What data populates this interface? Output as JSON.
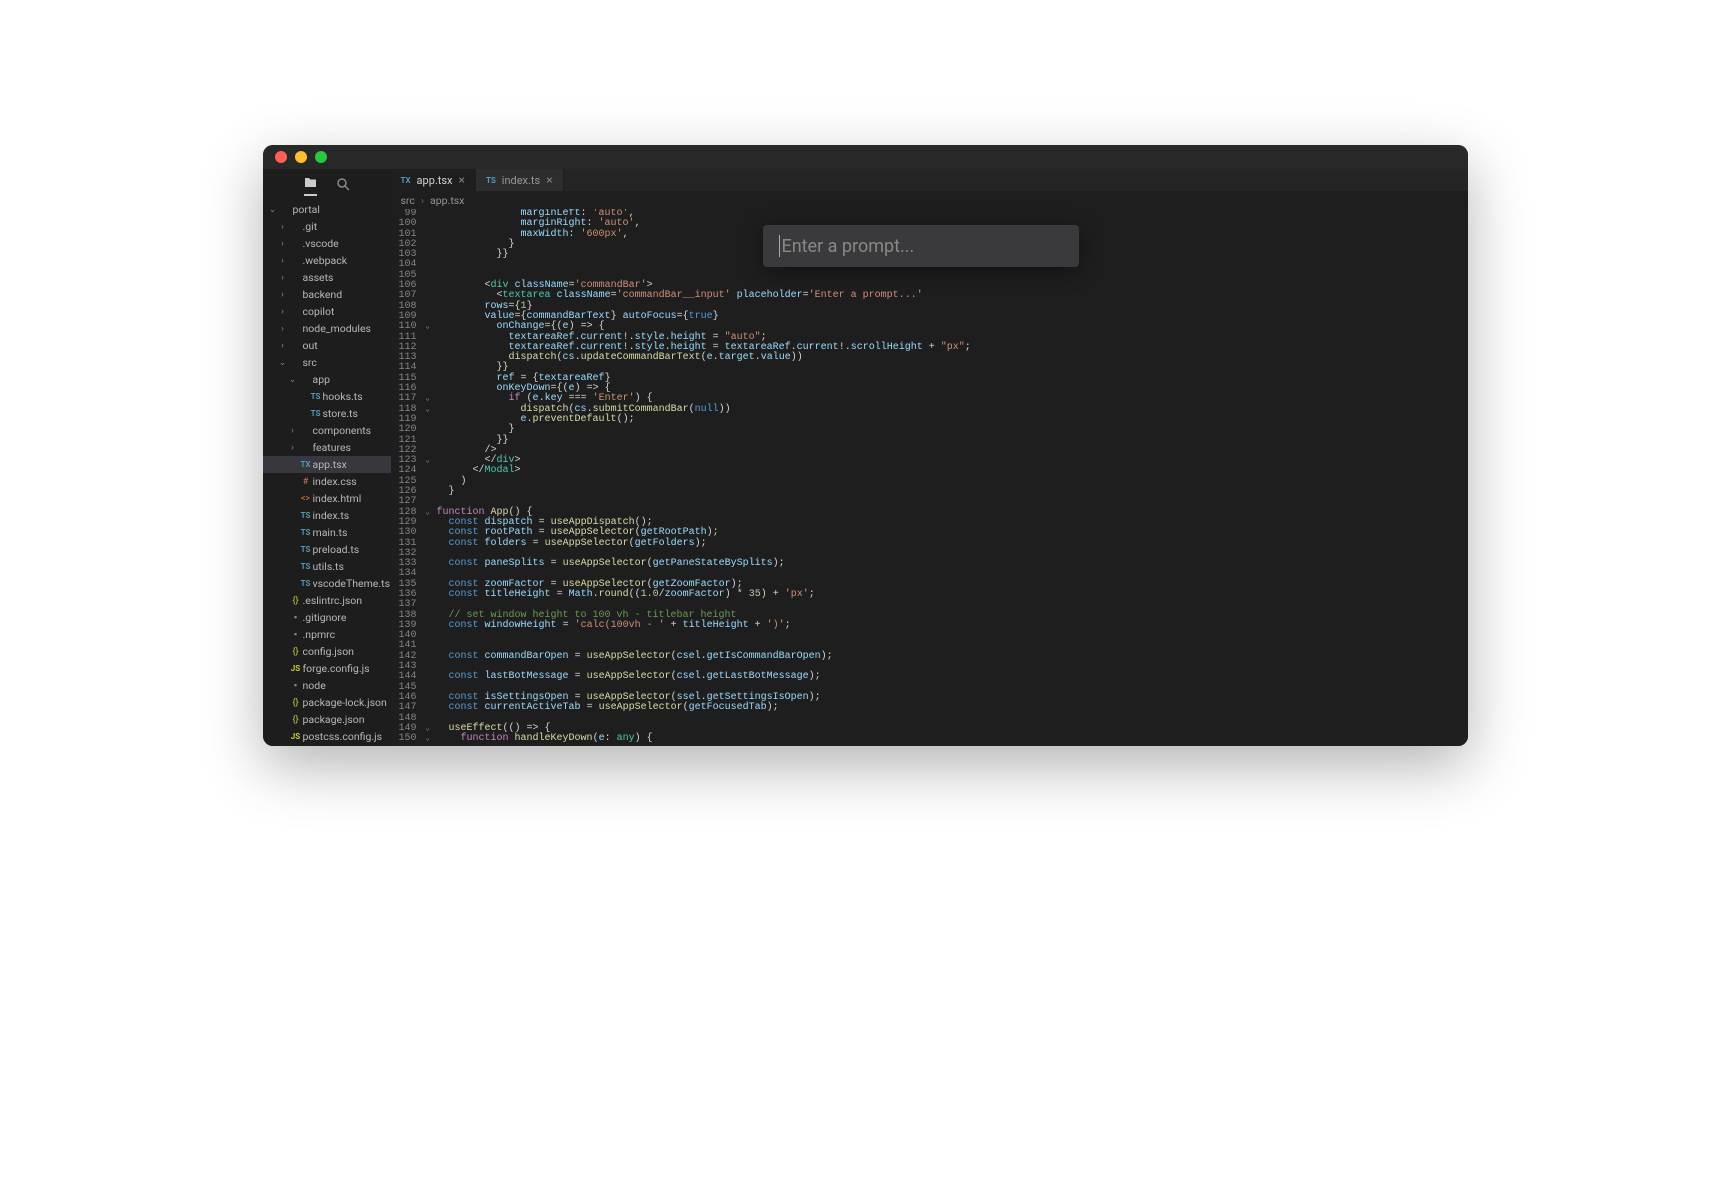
{
  "tabs": [
    {
      "icon": "TX",
      "label": "app.tsx",
      "active": true
    },
    {
      "icon": "TS",
      "label": "index.ts",
      "active": false
    }
  ],
  "breadcrumbs": [
    "src",
    "app.tsx"
  ],
  "prompt_placeholder": "Enter a prompt...",
  "sidebar_icons": {
    "folder": "folder-icon",
    "search": "search-icon"
  },
  "file_tree": [
    {
      "depth": 0,
      "chev": "v",
      "icon": "",
      "label": "portal",
      "type": "folder-open"
    },
    {
      "depth": 1,
      "chev": ">",
      "icon": "",
      "label": ".git",
      "type": "folder"
    },
    {
      "depth": 1,
      "chev": ">",
      "icon": "",
      "label": ".vscode",
      "type": "folder"
    },
    {
      "depth": 1,
      "chev": ">",
      "icon": "",
      "label": ".webpack",
      "type": "folder"
    },
    {
      "depth": 1,
      "chev": ">",
      "icon": "",
      "label": "assets",
      "type": "folder"
    },
    {
      "depth": 1,
      "chev": ">",
      "icon": "",
      "label": "backend",
      "type": "folder"
    },
    {
      "depth": 1,
      "chev": ">",
      "icon": "",
      "label": "copilot",
      "type": "folder"
    },
    {
      "depth": 1,
      "chev": ">",
      "icon": "",
      "label": "node_modules",
      "type": "folder"
    },
    {
      "depth": 1,
      "chev": ">",
      "icon": "",
      "label": "out",
      "type": "folder"
    },
    {
      "depth": 1,
      "chev": "v",
      "icon": "",
      "label": "src",
      "type": "folder-open"
    },
    {
      "depth": 2,
      "chev": "v",
      "icon": "",
      "label": "app",
      "type": "folder-open"
    },
    {
      "depth": 3,
      "chev": "",
      "icon": "TS",
      "label": "hooks.ts",
      "type": "ts"
    },
    {
      "depth": 3,
      "chev": "",
      "icon": "TS",
      "label": "store.ts",
      "type": "ts"
    },
    {
      "depth": 2,
      "chev": ">",
      "icon": "",
      "label": "components",
      "type": "folder"
    },
    {
      "depth": 2,
      "chev": ">",
      "icon": "",
      "label": "features",
      "type": "folder"
    },
    {
      "depth": 2,
      "chev": "",
      "icon": "TX",
      "label": "app.tsx",
      "type": "tx",
      "selected": true
    },
    {
      "depth": 2,
      "chev": "",
      "icon": "#",
      "label": "index.css",
      "type": "css"
    },
    {
      "depth": 2,
      "chev": "",
      "icon": "<>",
      "label": "index.html",
      "type": "html"
    },
    {
      "depth": 2,
      "chev": "",
      "icon": "TS",
      "label": "index.ts",
      "type": "ts"
    },
    {
      "depth": 2,
      "chev": "",
      "icon": "TS",
      "label": "main.ts",
      "type": "ts"
    },
    {
      "depth": 2,
      "chev": "",
      "icon": "TS",
      "label": "preload.ts",
      "type": "ts"
    },
    {
      "depth": 2,
      "chev": "",
      "icon": "TS",
      "label": "utils.ts",
      "type": "ts"
    },
    {
      "depth": 2,
      "chev": "",
      "icon": "TS",
      "label": "vscodeTheme.ts",
      "type": "ts"
    },
    {
      "depth": 1,
      "chev": "",
      "icon": "{}",
      "label": ".eslintrc.json",
      "type": "json"
    },
    {
      "depth": 1,
      "chev": "",
      "icon": "▪",
      "label": ".gitignore",
      "type": "file"
    },
    {
      "depth": 1,
      "chev": "",
      "icon": "▪",
      "label": ".npmrc",
      "type": "file"
    },
    {
      "depth": 1,
      "chev": "",
      "icon": "{}",
      "label": "config.json",
      "type": "json"
    },
    {
      "depth": 1,
      "chev": "",
      "icon": "JS",
      "label": "forge.config.js",
      "type": "js"
    },
    {
      "depth": 1,
      "chev": "",
      "icon": "▪",
      "label": "node",
      "type": "file"
    },
    {
      "depth": 1,
      "chev": "",
      "icon": "{}",
      "label": "package-lock.json",
      "type": "json"
    },
    {
      "depth": 1,
      "chev": "",
      "icon": "{}",
      "label": "package.json",
      "type": "json"
    },
    {
      "depth": 1,
      "chev": "",
      "icon": "JS",
      "label": "postcss.config.js",
      "type": "js"
    }
  ],
  "line_start": 99,
  "line_end": 150,
  "fold_marks": {
    "110": "v",
    "117": "v",
    "118": "v",
    "123": "v",
    "128": "v",
    "149": "v",
    "150": "v"
  },
  "code_lines": [
    [
      [
        "",
        "              "
      ],
      [
        "c-id",
        "marginLeft"
      ],
      [
        "c-pun",
        ": "
      ],
      [
        "c-str",
        "'auto'"
      ],
      [
        "c-pun",
        ","
      ]
    ],
    [
      [
        "",
        "              "
      ],
      [
        "c-id",
        "marginRight"
      ],
      [
        "c-pun",
        ": "
      ],
      [
        "c-str",
        "'auto'"
      ],
      [
        "c-pun",
        ","
      ]
    ],
    [
      [
        "",
        "              "
      ],
      [
        "c-id",
        "maxWidth"
      ],
      [
        "c-pun",
        ": "
      ],
      [
        "c-str",
        "'600px'"
      ],
      [
        "c-pun",
        ","
      ]
    ],
    [
      [
        "",
        "            }"
      ]
    ],
    [
      [
        "",
        "          }}"
      ]
    ],
    [
      [
        "",
        "        "
      ]
    ],
    [
      [
        "",
        " "
      ]
    ],
    [
      [
        "",
        "        "
      ],
      [
        "c-pun",
        "<"
      ],
      [
        "c-tag",
        "div"
      ],
      [
        "c-pun",
        " "
      ],
      [
        "c-attr",
        "className"
      ],
      [
        "c-pun",
        "="
      ],
      [
        "c-str",
        "'commandBar'"
      ],
      [
        "c-pun",
        ">"
      ]
    ],
    [
      [
        "",
        "          "
      ],
      [
        "c-pun",
        "<"
      ],
      [
        "c-tag",
        "textarea"
      ],
      [
        "c-pun",
        " "
      ],
      [
        "c-attr",
        "className"
      ],
      [
        "c-pun",
        "="
      ],
      [
        "c-str",
        "'commandBar__input'"
      ],
      [
        "c-pun",
        " "
      ],
      [
        "c-attr",
        "placeholder"
      ],
      [
        "c-pun",
        "="
      ],
      [
        "c-str",
        "'Enter a prompt...'"
      ]
    ],
    [
      [
        "",
        "        "
      ],
      [
        "c-attr",
        "rows"
      ],
      [
        "c-pun",
        "={"
      ],
      [
        "c-num",
        "1"
      ],
      [
        "c-pun",
        "}"
      ]
    ],
    [
      [
        "",
        "        "
      ],
      [
        "c-attr",
        "value"
      ],
      [
        "c-pun",
        "={"
      ],
      [
        "c-id",
        "commandBarText"
      ],
      [
        "c-pun",
        "} "
      ],
      [
        "c-attr",
        "autoFocus"
      ],
      [
        "c-pun",
        "={"
      ],
      [
        "c-bool",
        "true"
      ],
      [
        "c-pun",
        "}"
      ]
    ],
    [
      [
        "",
        "          "
      ],
      [
        "c-attr",
        "onChange"
      ],
      [
        "c-pun",
        "={("
      ],
      [
        "c-id",
        "e"
      ],
      [
        "c-pun",
        ") => {"
      ]
    ],
    [
      [
        "",
        "            "
      ],
      [
        "c-id",
        "textareaRef"
      ],
      [
        "c-pun",
        "."
      ],
      [
        "c-id",
        "current"
      ],
      [
        "c-pun",
        "!."
      ],
      [
        "c-id",
        "style"
      ],
      [
        "c-pun",
        "."
      ],
      [
        "c-id",
        "height"
      ],
      [
        "c-pun",
        " = "
      ],
      [
        "c-str",
        "\"auto\""
      ],
      [
        "c-pun",
        ";"
      ]
    ],
    [
      [
        "",
        "            "
      ],
      [
        "c-id",
        "textareaRef"
      ],
      [
        "c-pun",
        "."
      ],
      [
        "c-id",
        "current"
      ],
      [
        "c-pun",
        "!."
      ],
      [
        "c-id",
        "style"
      ],
      [
        "c-pun",
        "."
      ],
      [
        "c-id",
        "height"
      ],
      [
        "c-pun",
        " = "
      ],
      [
        "c-id",
        "textareaRef"
      ],
      [
        "c-pun",
        "."
      ],
      [
        "c-id",
        "current"
      ],
      [
        "c-pun",
        "!."
      ],
      [
        "c-id",
        "scrollHeight"
      ],
      [
        "c-pun",
        " + "
      ],
      [
        "c-str",
        "\"px\""
      ],
      [
        "c-pun",
        ";"
      ]
    ],
    [
      [
        "",
        "            "
      ],
      [
        "c-fn",
        "dispatch"
      ],
      [
        "c-pun",
        "("
      ],
      [
        "c-id",
        "cs"
      ],
      [
        "c-pun",
        "."
      ],
      [
        "c-fn",
        "updateCommandBarText"
      ],
      [
        "c-pun",
        "("
      ],
      [
        "c-id",
        "e"
      ],
      [
        "c-pun",
        "."
      ],
      [
        "c-id",
        "target"
      ],
      [
        "c-pun",
        "."
      ],
      [
        "c-id",
        "value"
      ],
      [
        "c-pun",
        "))"
      ]
    ],
    [
      [
        "",
        "          }}"
      ]
    ],
    [
      [
        "",
        "          "
      ],
      [
        "c-attr",
        "ref"
      ],
      [
        "c-pun",
        " = {"
      ],
      [
        "c-id",
        "textareaRef"
      ],
      [
        "c-pun",
        "}"
      ]
    ],
    [
      [
        "",
        "          "
      ],
      [
        "c-attr",
        "onKeyDown"
      ],
      [
        "c-pun",
        "={("
      ],
      [
        "c-id",
        "e"
      ],
      [
        "c-pun",
        ") => {"
      ]
    ],
    [
      [
        "",
        "            "
      ],
      [
        "c-kw",
        "if"
      ],
      [
        "c-pun",
        " ("
      ],
      [
        "c-id",
        "e"
      ],
      [
        "c-pun",
        "."
      ],
      [
        "c-id",
        "key"
      ],
      [
        "c-pun",
        " === "
      ],
      [
        "c-str",
        "'Enter'"
      ],
      [
        "c-pun",
        ") {"
      ]
    ],
    [
      [
        "",
        "              "
      ],
      [
        "c-fn",
        "dispatch"
      ],
      [
        "c-pun",
        "("
      ],
      [
        "c-id",
        "cs"
      ],
      [
        "c-pun",
        "."
      ],
      [
        "c-fn",
        "submitCommandBar"
      ],
      [
        "c-pun",
        "("
      ],
      [
        "c-bool",
        "null"
      ],
      [
        "c-pun",
        "))"
      ]
    ],
    [
      [
        "",
        "              "
      ],
      [
        "c-id",
        "e"
      ],
      [
        "c-pun",
        "."
      ],
      [
        "c-fn",
        "preventDefault"
      ],
      [
        "c-pun",
        "();"
      ]
    ],
    [
      [
        "",
        "            }"
      ]
    ],
    [
      [
        "",
        "          }}"
      ]
    ],
    [
      [
        "",
        "        />"
      ]
    ],
    [
      [
        "",
        "        </"
      ],
      [
        "c-tag",
        "div"
      ],
      [
        "c-pun",
        ">"
      ]
    ],
    [
      [
        "",
        "      </"
      ],
      [
        "c-tag",
        "Modal"
      ],
      [
        "c-pun",
        ">"
      ]
    ],
    [
      [
        "",
        "    )"
      ]
    ],
    [
      [
        "",
        "  }"
      ]
    ],
    [
      [
        "",
        " "
      ]
    ],
    [
      [
        "c-kw",
        "function"
      ],
      [
        "c-pun",
        " "
      ],
      [
        "c-fn",
        "App"
      ],
      [
        "c-pun",
        "() {"
      ]
    ],
    [
      [
        "",
        "  "
      ],
      [
        "c-var",
        "const"
      ],
      [
        "c-pun",
        " "
      ],
      [
        "c-id",
        "dispatch"
      ],
      [
        "c-pun",
        " = "
      ],
      [
        "c-fn",
        "useAppDispatch"
      ],
      [
        "c-pun",
        "();"
      ]
    ],
    [
      [
        "",
        "  "
      ],
      [
        "c-var",
        "const"
      ],
      [
        "c-pun",
        " "
      ],
      [
        "c-id",
        "rootPath"
      ],
      [
        "c-pun",
        " = "
      ],
      [
        "c-fn",
        "useAppSelector"
      ],
      [
        "c-pun",
        "("
      ],
      [
        "c-id",
        "getRootPath"
      ],
      [
        "c-pun",
        ");"
      ]
    ],
    [
      [
        "",
        "  "
      ],
      [
        "c-var",
        "const"
      ],
      [
        "c-pun",
        " "
      ],
      [
        "c-id",
        "folders"
      ],
      [
        "c-pun",
        " = "
      ],
      [
        "c-fn",
        "useAppSelector"
      ],
      [
        "c-pun",
        "("
      ],
      [
        "c-id",
        "getFolders"
      ],
      [
        "c-pun",
        ");"
      ]
    ],
    [
      [
        "",
        " "
      ]
    ],
    [
      [
        "",
        "  "
      ],
      [
        "c-var",
        "const"
      ],
      [
        "c-pun",
        " "
      ],
      [
        "c-id",
        "paneSplits"
      ],
      [
        "c-pun",
        " = "
      ],
      [
        "c-fn",
        "useAppSelector"
      ],
      [
        "c-pun",
        "("
      ],
      [
        "c-id",
        "getPaneStateBySplits"
      ],
      [
        "c-pun",
        ");"
      ]
    ],
    [
      [
        "",
        " "
      ]
    ],
    [
      [
        "",
        "  "
      ],
      [
        "c-var",
        "const"
      ],
      [
        "c-pun",
        " "
      ],
      [
        "c-id",
        "zoomFactor"
      ],
      [
        "c-pun",
        " = "
      ],
      [
        "c-fn",
        "useAppSelector"
      ],
      [
        "c-pun",
        "("
      ],
      [
        "c-id",
        "getZoomFactor"
      ],
      [
        "c-pun",
        ");"
      ]
    ],
    [
      [
        "",
        "  "
      ],
      [
        "c-var",
        "const"
      ],
      [
        "c-pun",
        " "
      ],
      [
        "c-id",
        "titleHeight"
      ],
      [
        "c-pun",
        " = "
      ],
      [
        "c-id",
        "Math"
      ],
      [
        "c-pun",
        "."
      ],
      [
        "c-fn",
        "round"
      ],
      [
        "c-pun",
        "(("
      ],
      [
        "c-num",
        "1.0"
      ],
      [
        "c-pun",
        "/"
      ],
      [
        "c-id",
        "zoomFactor"
      ],
      [
        "c-pun",
        ") * "
      ],
      [
        "c-num",
        "35"
      ],
      [
        "c-pun",
        ") + "
      ],
      [
        "c-str",
        "'px'"
      ],
      [
        "c-pun",
        ";"
      ]
    ],
    [
      [
        "",
        " "
      ]
    ],
    [
      [
        "",
        "  "
      ],
      [
        "c-com",
        "// set window height to 100 vh - titlebar height"
      ]
    ],
    [
      [
        "",
        "  "
      ],
      [
        "c-var",
        "const"
      ],
      [
        "c-pun",
        " "
      ],
      [
        "c-id",
        "windowHeight"
      ],
      [
        "c-pun",
        " = "
      ],
      [
        "c-str",
        "'calc(100vh - '"
      ],
      [
        "c-pun",
        " + "
      ],
      [
        "c-id",
        "titleHeight"
      ],
      [
        "c-pun",
        " + "
      ],
      [
        "c-str",
        "')'"
      ],
      [
        "c-pun",
        ";"
      ]
    ],
    [
      [
        "",
        " "
      ]
    ],
    [
      [
        "",
        " "
      ]
    ],
    [
      [
        "",
        "  "
      ],
      [
        "c-var",
        "const"
      ],
      [
        "c-pun",
        " "
      ],
      [
        "c-id",
        "commandBarOpen"
      ],
      [
        "c-pun",
        " = "
      ],
      [
        "c-fn",
        "useAppSelector"
      ],
      [
        "c-pun",
        "("
      ],
      [
        "c-id",
        "csel"
      ],
      [
        "c-pun",
        "."
      ],
      [
        "c-id",
        "getIsCommandBarOpen"
      ],
      [
        "c-pun",
        ");"
      ]
    ],
    [
      [
        "",
        " "
      ]
    ],
    [
      [
        "",
        "  "
      ],
      [
        "c-var",
        "const"
      ],
      [
        "c-pun",
        " "
      ],
      [
        "c-id",
        "lastBotMessage"
      ],
      [
        "c-pun",
        " = "
      ],
      [
        "c-fn",
        "useAppSelector"
      ],
      [
        "c-pun",
        "("
      ],
      [
        "c-id",
        "csel"
      ],
      [
        "c-pun",
        "."
      ],
      [
        "c-id",
        "getLastBotMessage"
      ],
      [
        "c-pun",
        ");"
      ]
    ],
    [
      [
        "",
        " "
      ]
    ],
    [
      [
        "",
        "  "
      ],
      [
        "c-var",
        "const"
      ],
      [
        "c-pun",
        " "
      ],
      [
        "c-id",
        "isSettingsOpen"
      ],
      [
        "c-pun",
        " = "
      ],
      [
        "c-fn",
        "useAppSelector"
      ],
      [
        "c-pun",
        "("
      ],
      [
        "c-id",
        "ssel"
      ],
      [
        "c-pun",
        "."
      ],
      [
        "c-id",
        "getSettingsIsOpen"
      ],
      [
        "c-pun",
        ");"
      ]
    ],
    [
      [
        "",
        "  "
      ],
      [
        "c-var",
        "const"
      ],
      [
        "c-pun",
        " "
      ],
      [
        "c-id",
        "currentActiveTab"
      ],
      [
        "c-pun",
        " = "
      ],
      [
        "c-fn",
        "useAppSelector"
      ],
      [
        "c-pun",
        "("
      ],
      [
        "c-id",
        "getFocusedTab"
      ],
      [
        "c-pun",
        ");"
      ]
    ],
    [
      [
        "",
        " "
      ]
    ],
    [
      [
        "",
        "  "
      ],
      [
        "c-fn",
        "useEffect"
      ],
      [
        "c-pun",
        "(() => {"
      ]
    ],
    [
      [
        "",
        "    "
      ],
      [
        "c-kw",
        "function"
      ],
      [
        "c-pun",
        " "
      ],
      [
        "c-fn",
        "handleKeyDown"
      ],
      [
        "c-pun",
        "("
      ],
      [
        "c-id",
        "e"
      ],
      [
        "c-pun",
        ": "
      ],
      [
        "c-type",
        "any"
      ],
      [
        "c-pun",
        ") {"
      ]
    ]
  ]
}
